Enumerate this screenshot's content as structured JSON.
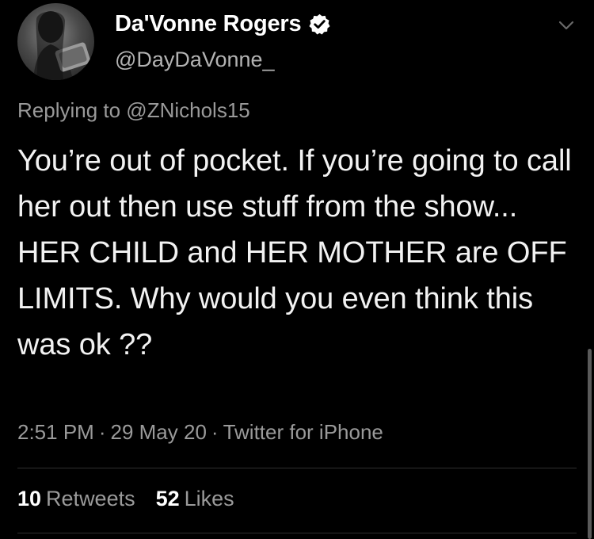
{
  "tweet": {
    "author": {
      "display_name": "Da'Vonne Rogers",
      "handle": "@DayDaVonne_",
      "verified": true
    },
    "reply_context": "Replying to @ZNichols15",
    "text": "You’re out of pocket. If you’re going to call her out then use stuff from the show... HER CHILD and HER MOTHER are OFF LIMITS. Why would you even think this was ok ??",
    "time": "2:51 PM",
    "date": "29 May 20",
    "source": "Twitter for iPhone",
    "separator": "·",
    "stats": {
      "retweets_count": "10",
      "retweets_label": "Retweets",
      "likes_count": "52",
      "likes_label": "Likes"
    }
  },
  "icons": {
    "verified": "verified-badge-icon",
    "menu": "chevron-down-icon"
  },
  "colors": {
    "background": "#000000",
    "primary_text": "#ffffff",
    "secondary_text": "#9a9a9a"
  }
}
